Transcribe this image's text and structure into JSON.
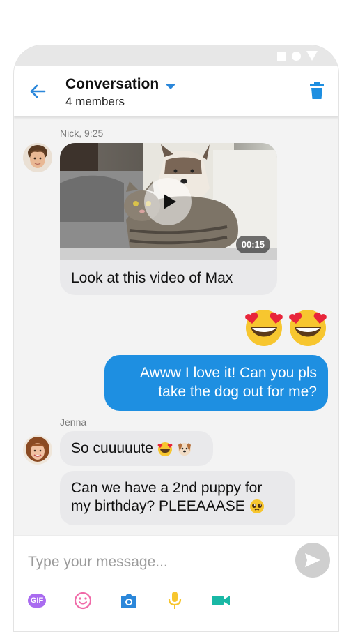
{
  "colors": {
    "accent": "#1e8fe1",
    "bubble_in": "#e9e9eb",
    "gif": "#a96bf0",
    "emoji_yellow": "#f7c62f",
    "camera": "#2b87da",
    "video": "#19b8a5"
  },
  "header": {
    "title": "Conversation",
    "subtitle": "4 members"
  },
  "messages": [
    {
      "sender": "Nick, 9:25",
      "video_duration": "00:15",
      "caption": "Look at this video of Max"
    },
    {
      "sender": "me",
      "reaction_icons": [
        "heart-eyes-emoji",
        "heart-eyes-emoji"
      ]
    },
    {
      "sender": "me",
      "text_line1": "Awww I love it! Can you pls",
      "text_line2": "take the dog out for me?"
    },
    {
      "sender": "Jenna",
      "text": "So cuuuuute",
      "icons": [
        "heart-eyes-emoji",
        "dog-emoji"
      ]
    },
    {
      "sender": "Jenna",
      "text_line1": "Can we have a 2nd puppy for",
      "text_line2": "my birthday? PLEEAAASE",
      "icons": [
        "pleading-face-emoji"
      ]
    }
  ],
  "composer": {
    "placeholder": "Type your message...",
    "gif_label": "GIF"
  }
}
